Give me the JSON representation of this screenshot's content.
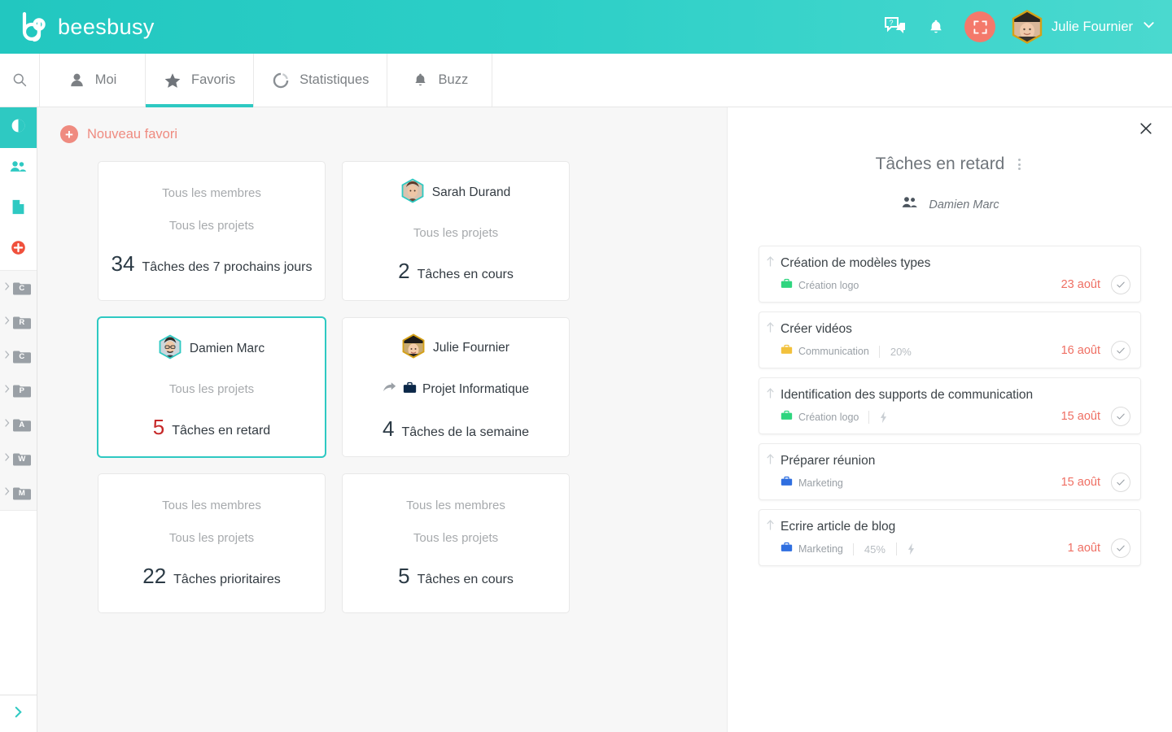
{
  "app": {
    "brand_name": "beesbusy",
    "brand_logo_icon": "beesbusy-logo-icon"
  },
  "topbar": {
    "chat_icon": "chat-help-icon",
    "bell_icon": "notification-bell-icon",
    "fullscreen_icon": "fullscreen-icon",
    "avatar_icon": "user-avatar",
    "user_name": "Julie Fournier",
    "chevron_icon": "chevron-down-icon"
  },
  "nav": {
    "search_icon": "search-icon",
    "tabs": [
      {
        "label": "Moi",
        "icon": "person-icon",
        "active": false
      },
      {
        "label": "Favoris",
        "icon": "star-icon",
        "active": true
      },
      {
        "label": "Statistiques",
        "icon": "donut-chart-icon",
        "active": false
      },
      {
        "label": "Buzz",
        "icon": "bell-icon",
        "active": false
      }
    ]
  },
  "sidebar": {
    "top_items": [
      {
        "icon": "dashboard-pie-icon",
        "active": true
      },
      {
        "icon": "people-icon",
        "active": false
      },
      {
        "icon": "document-icon",
        "active": false
      },
      {
        "icon": "add-plus-icon",
        "active": false
      }
    ],
    "folders": [
      {
        "letter": "C"
      },
      {
        "letter": "R"
      },
      {
        "letter": "C"
      },
      {
        "letter": "P"
      },
      {
        "letter": "A"
      },
      {
        "letter": "W"
      },
      {
        "letter": "M"
      }
    ],
    "expand_icon": "chevron-right-icon"
  },
  "main": {
    "new_favorite_label": "Nouveau favori",
    "new_favorite_icon": "plus-circle-icon",
    "cards": [
      {
        "scope_member": "Tous les membres",
        "scope_project": "Tous les projets",
        "count": "34",
        "count_label": "Tâches des 7 prochains jours",
        "selected": false,
        "late": false,
        "member_avatar": null,
        "member_name": null,
        "project_name": null
      },
      {
        "scope_member": null,
        "scope_project": "Tous les projets",
        "count": "2",
        "count_label": "Tâches en cours",
        "selected": false,
        "late": false,
        "member_avatar": "sarah-durand-avatar",
        "member_name": "Sarah Durand",
        "project_name": null
      },
      {
        "scope_member": null,
        "scope_project": "Tous les projets",
        "count": "5",
        "count_label": "Tâches en retard",
        "selected": true,
        "late": true,
        "member_avatar": "damien-marc-avatar",
        "member_name": "Damien Marc",
        "project_name": null
      },
      {
        "scope_member": null,
        "scope_project": null,
        "count": "4",
        "count_label": "Tâches de la semaine",
        "selected": false,
        "late": false,
        "member_avatar": "julie-fournier-avatar",
        "member_name": "Julie Fournier",
        "project_name": "Projet Informatique"
      },
      {
        "scope_member": "Tous les membres",
        "scope_project": "Tous les projets",
        "count": "22",
        "count_label": "Tâches prioritaires",
        "selected": false,
        "late": false,
        "member_avatar": null,
        "member_name": null,
        "project_name": null
      },
      {
        "scope_member": "Tous les membres",
        "scope_project": "Tous les projets",
        "count": "5",
        "count_label": "Tâches en cours",
        "selected": false,
        "late": false,
        "member_avatar": null,
        "member_name": null,
        "project_name": null
      }
    ]
  },
  "panel": {
    "close_icon": "close-icon",
    "title": "Tâches en retard",
    "menu_icon": "kebab-menu-icon",
    "members_icon": "people-icon",
    "member_filter": "Damien Marc",
    "tasks": [
      {
        "title": "Création de modèles types",
        "project": "Création logo",
        "project_color": "#2fd57f",
        "percent": null,
        "blocked": false,
        "date": "23 août",
        "priority_icon": "priority-up-arrow-icon",
        "check_icon": "check-icon"
      },
      {
        "title": "Créer vidéos",
        "project": "Communication",
        "project_color": "#f2c13c",
        "percent": "20%",
        "blocked": false,
        "date": "16 août",
        "priority_icon": "priority-up-arrow-icon",
        "check_icon": "check-icon"
      },
      {
        "title": "Identification des supports de communication",
        "project": "Création logo",
        "project_color": "#2fd57f",
        "percent": null,
        "blocked": true,
        "date": "15 août",
        "priority_icon": "priority-up-arrow-icon",
        "check_icon": "check-icon"
      },
      {
        "title": "Préparer réunion",
        "project": "Marketing",
        "project_color": "#2f6fe0",
        "percent": null,
        "blocked": false,
        "date": "15 août",
        "priority_icon": "priority-up-arrow-icon",
        "check_icon": "check-icon"
      },
      {
        "title": "Ecrire article de blog",
        "project": "Marketing",
        "project_color": "#2f6fe0",
        "percent": "45%",
        "blocked": true,
        "date": "1 août",
        "priority_icon": "priority-up-arrow-icon",
        "check_icon": "check-icon"
      }
    ]
  },
  "colors": {
    "brand_teal": "#2ec9c2",
    "accent_coral": "#f4796b",
    "late_red": "#c62828",
    "date_red": "#ef6f63",
    "content_bg": "#f7f7f7"
  }
}
